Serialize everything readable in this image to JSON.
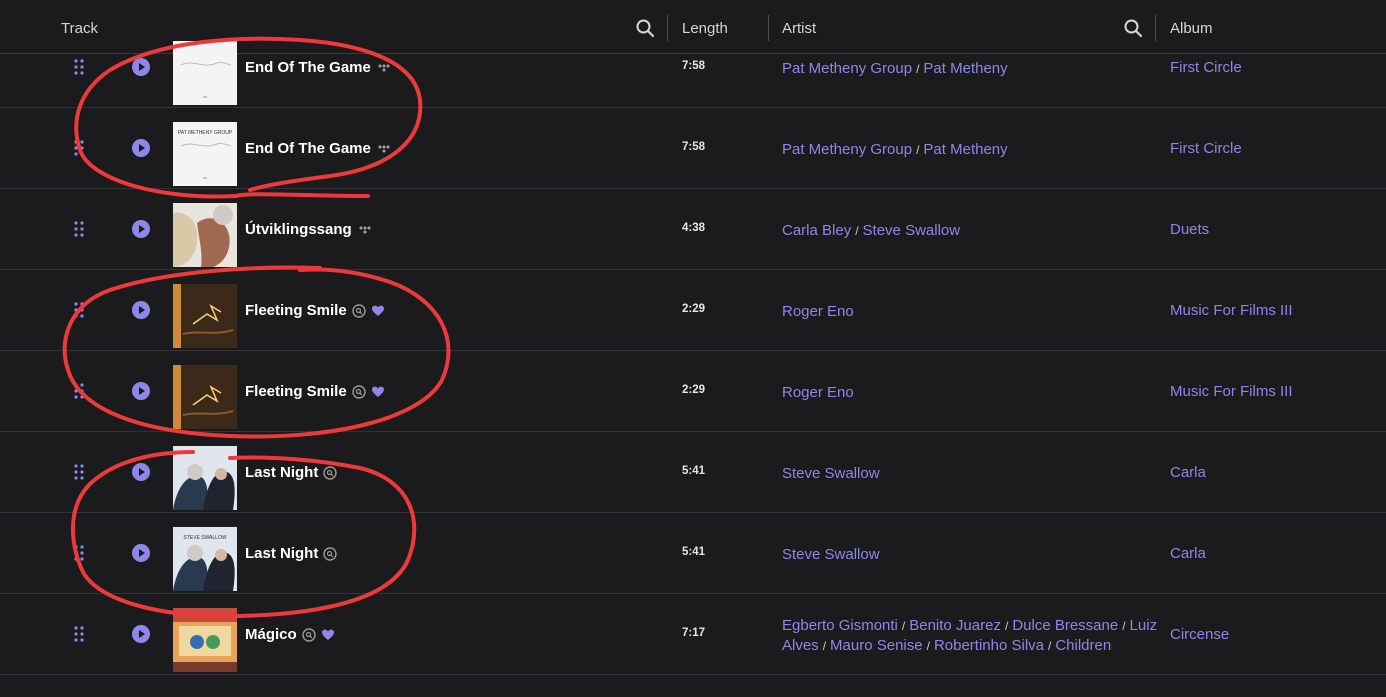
{
  "header": {
    "track": "Track",
    "length": "Length",
    "artist": "Artist",
    "album": "Album"
  },
  "colors": {
    "accent": "#8e87ea",
    "background": "#1b1a1c",
    "annotation": "#ec3a3a"
  },
  "rows": [
    {
      "title": "End Of The Game",
      "icon": "tidal-icon",
      "length": "7:58",
      "artists": [
        "Pat Metheny Group",
        "Pat Metheny"
      ],
      "album": "First Circle",
      "art": "first-circle-cover"
    },
    {
      "title": "End Of The Game",
      "icon": "tidal-icon",
      "length": "7:58",
      "artists": [
        "Pat Metheny Group",
        "Pat Metheny"
      ],
      "album": "First Circle",
      "art": "first-circle-cover",
      "art_text": "PAT METHENY GROUP"
    },
    {
      "title": "Útviklingssang",
      "icon": "tidal-icon",
      "length": "4:38",
      "artists": [
        "Carla Bley",
        "Steve Swallow"
      ],
      "album": "Duets",
      "art": "duets-cover"
    },
    {
      "title": "Fleeting Smile",
      "icon": "local-search-icon",
      "heart": true,
      "length": "2:29",
      "artists": [
        "Roger Eno"
      ],
      "album": "Music For Films III",
      "art": "music-for-films-cover"
    },
    {
      "title": "Fleeting Smile",
      "icon": "local-search-icon",
      "heart": true,
      "length": "2:29",
      "artists": [
        "Roger Eno"
      ],
      "album": "Music For Films III",
      "art": "music-for-films-cover"
    },
    {
      "title": "Last Night",
      "icon": "local-search-icon",
      "length": "5:41",
      "artists": [
        "Steve Swallow"
      ],
      "album": "Carla",
      "art": "carla-cover"
    },
    {
      "title": "Last Night",
      "icon": "local-search-icon",
      "length": "5:41",
      "artists": [
        "Steve Swallow"
      ],
      "album": "Carla",
      "art": "carla-cover",
      "art_text": "STEVE SWALLOW"
    },
    {
      "title": "Mágico",
      "icon": "local-search-icon",
      "heart": true,
      "length": "7:17",
      "artists": [
        "Egberto Gismonti",
        "Benito Juarez",
        "Dulce Bressane",
        "Luiz Alves",
        "Mauro Senise",
        "Robertinho Silva",
        "Children"
      ],
      "album": "Circense",
      "art": "circense-cover"
    }
  ]
}
